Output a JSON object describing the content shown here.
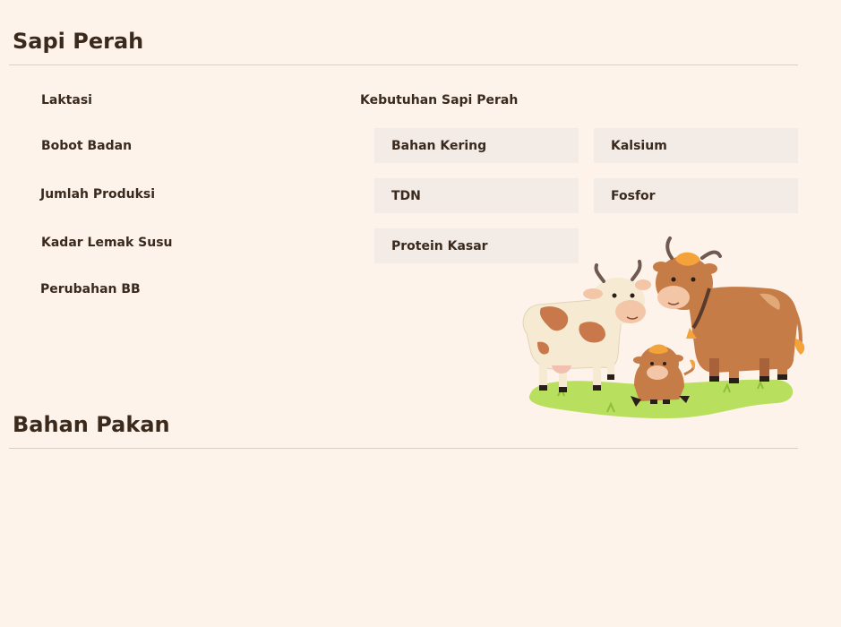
{
  "sections": {
    "sapi_perah": "Sapi Perah",
    "bahan_pakan": "Bahan Pakan"
  },
  "inputs": {
    "laktasi": "Laktasi",
    "bobot_badan": "Bobot Badan",
    "jumlah_produksi": "Jumlah Produksi",
    "kadar_lemak_susu": "Kadar Lemak Susu",
    "perubahan_bb": "Perubahan BB"
  },
  "kebutuhan": {
    "title": "Kebutuhan Sapi Perah",
    "bahan_kering": "Bahan Kering",
    "kalsium": "Kalsium",
    "tdn": "TDN",
    "fosfor": "Fosfor",
    "protein_kasar": "Protein Kasar"
  },
  "colors": {
    "background": "#fdf3eb",
    "field_bg": "#f2ebe6",
    "text": "#3a2a1e"
  },
  "illustration": {
    "icon": "cow-family-illustration"
  }
}
